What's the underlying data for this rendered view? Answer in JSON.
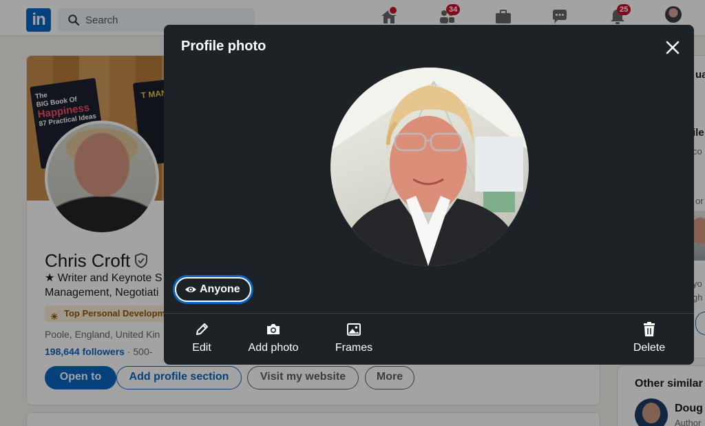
{
  "nav": {
    "logo": "in",
    "search_placeholder": "Search",
    "badges": {
      "home": "",
      "network": "34",
      "notifications": "25"
    },
    "icons": [
      "home-icon",
      "my-network-icon",
      "jobs-icon",
      "messaging-icon",
      "notifications-icon",
      "me-avatar"
    ]
  },
  "profile": {
    "name": "Chris Croft",
    "headline_line1": "★ Writer and Keynote S",
    "headline_line2": "Management, Negotiati",
    "top_badge": "Top Personal Developm",
    "location": "Poole, England, United Kin",
    "followers": "198,644 followers",
    "connections_frag": "· 500-",
    "banner_book1_line1": "The",
    "banner_book1_line2": "BIG Book Of",
    "banner_book1_line3": "Happiness",
    "banner_book1_line4": "87 Practical Ideas",
    "banner_book2": "T MAN",
    "buttons": {
      "open_to": "Open to",
      "add_section": "Add profile section",
      "website": "Visit my website",
      "more": "More"
    }
  },
  "right_rail": {
    "frag1": "ua",
    "frag2": "ile",
    "frag3": "co",
    "frag4": "or",
    "frag5": "yo",
    "frag6": "gh",
    "similar_title": "Other similar",
    "person_name": "Doug",
    "person_sub": "Author"
  },
  "modal": {
    "title": "Profile photo",
    "visibility": "Anyone",
    "actions": {
      "edit": "Edit",
      "add_photo": "Add photo",
      "frames": "Frames",
      "delete": "Delete"
    }
  },
  "colors": {
    "brand": "#0a66c2",
    "modal_bg": "#1d2226",
    "badge_red": "#cb112d"
  }
}
